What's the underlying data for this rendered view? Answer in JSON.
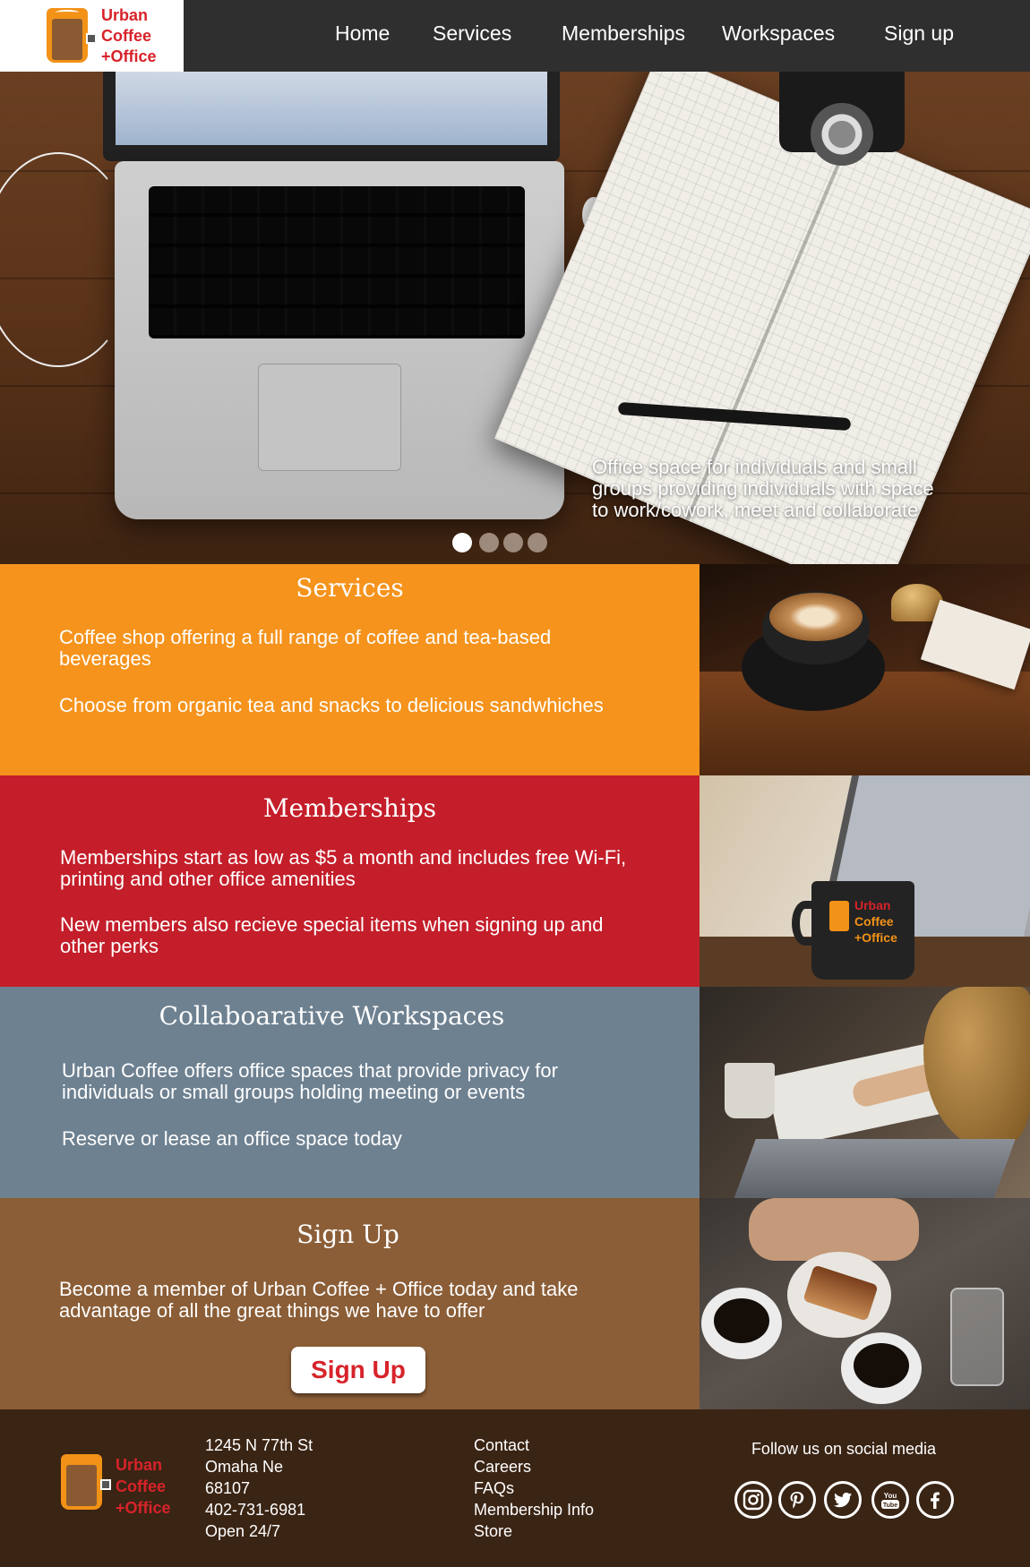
{
  "brand": {
    "logo_line1": "Urban",
    "logo_line2": "Coffee",
    "logo_line3": "+Office",
    "color_red": "#d7232a",
    "color_orange": "#f29217"
  },
  "nav": {
    "items": [
      {
        "label": "Home"
      },
      {
        "label": "Services"
      },
      {
        "label": "Memberships"
      },
      {
        "label": "Workspaces"
      },
      {
        "label": "Sign up"
      }
    ]
  },
  "hero": {
    "caption_line1": "Office space for individuals and small",
    "caption_line2": "groups providing individuals with space",
    "caption_line3": "to work/cowork, meet and collaborate",
    "slides_total": 4,
    "active_slide": 1
  },
  "sections": {
    "services": {
      "title": "Services",
      "p1_line1": "Coffee shop offering a full range of coffee and tea-based",
      "p1_line2": "beverages",
      "p2": "Choose from organic tea and snacks to delicious sandwhiches",
      "color": "#f5931c"
    },
    "memberships": {
      "title": "Memberships",
      "p1_line1": "Memberships start as low as $5 a month and includes free Wi-Fi,",
      "p1_line2": "printing and other office amenities",
      "p2_line1": "New members also recieve special items when signing up and",
      "p2_line2": "other perks",
      "color": "#c41e2a"
    },
    "workspaces": {
      "title": "Collaboarative Workspaces",
      "p1_line1": "Urban Coffee offers office spaces that provide privacy for",
      "p1_line2": "individuals or small groups holding meeting or events",
      "p2": "Reserve or lease an office space today",
      "color": "#6e8191"
    },
    "signup": {
      "title": "Sign Up",
      "p1_line1": "Become a member of Urban Coffee + Office today and take",
      "p1_line2": "advantage of all the great things we have to offer",
      "button_label": "Sign Up",
      "color": "#8b5e37"
    }
  },
  "footer": {
    "address": [
      "1245 N 77th St",
      "Omaha Ne",
      "68107",
      "402-731-6981",
      "Open 24/7"
    ],
    "links": [
      "Contact",
      "Careers",
      "FAQs",
      "Membership Info",
      "Store"
    ],
    "social_title": "Follow us on social media",
    "social_icons": [
      "instagram-icon",
      "pinterest-icon",
      "twitter-icon",
      "youtube-icon",
      "facebook-icon"
    ],
    "youtube_text": "You Tube"
  }
}
